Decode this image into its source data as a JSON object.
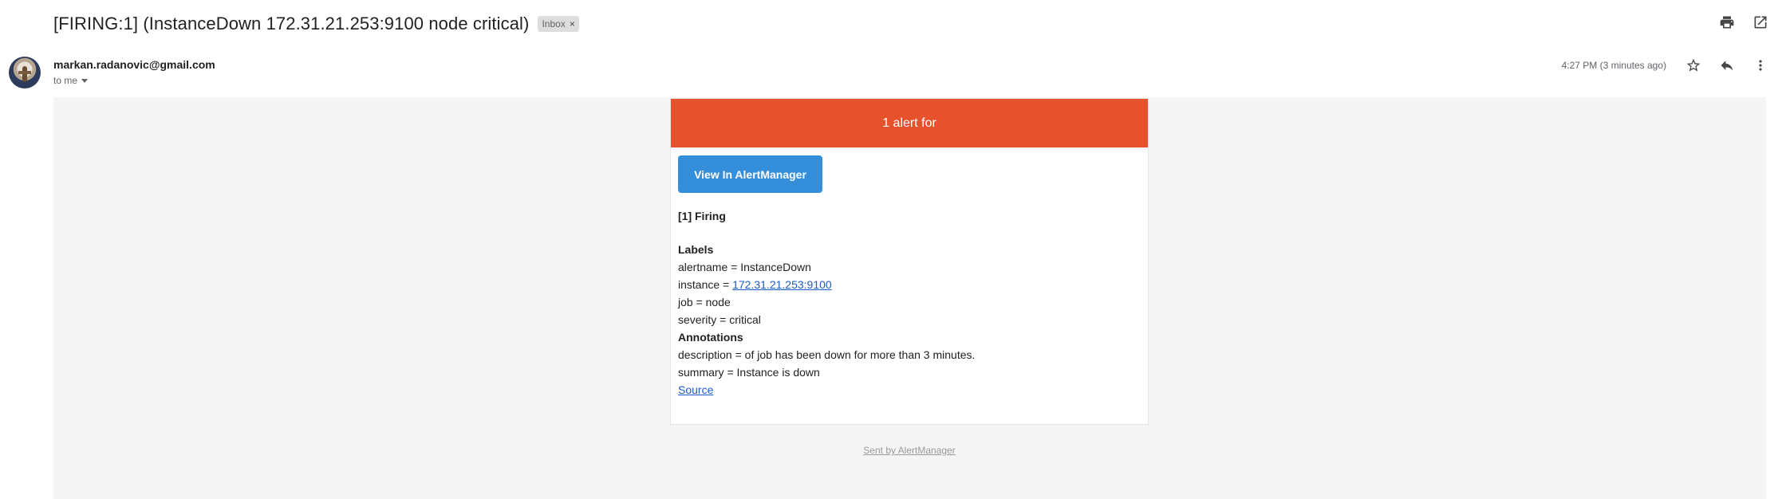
{
  "subject": "[FIRING:1] (InstanceDown 172.31.21.253:9100 node critical)",
  "label_chip": "Inbox",
  "chip_close": "×",
  "sender": "markan.radanovic@gmail.com",
  "to": "to me",
  "timestamp": "4:27 PM (3 minutes ago)",
  "alert": {
    "banner": "1 alert for",
    "button_label": "View In AlertManager",
    "firing_heading": "[1] Firing",
    "labels_heading": "Labels",
    "alertname": "alertname = InstanceDown",
    "instance_prefix": "instance = ",
    "instance_link": "172.31.21.253:9100",
    "job": "job = node",
    "severity": "severity = critical",
    "annotations_heading": "Annotations",
    "description": "description = of job has been down for more than 3 minutes.",
    "summary": "summary = Instance is down",
    "source_link": "Source"
  },
  "footer": "Sent by AlertManager",
  "colors": {
    "banner": "#e6522c",
    "button": "#348eda",
    "body_bg": "#f5f5f5",
    "link": "#1a5bc9"
  },
  "icons": [
    "print-icon",
    "open-in-new-window-icon",
    "star-icon",
    "reply-icon",
    "more-vertical-icon",
    "chevron-down-icon"
  ]
}
